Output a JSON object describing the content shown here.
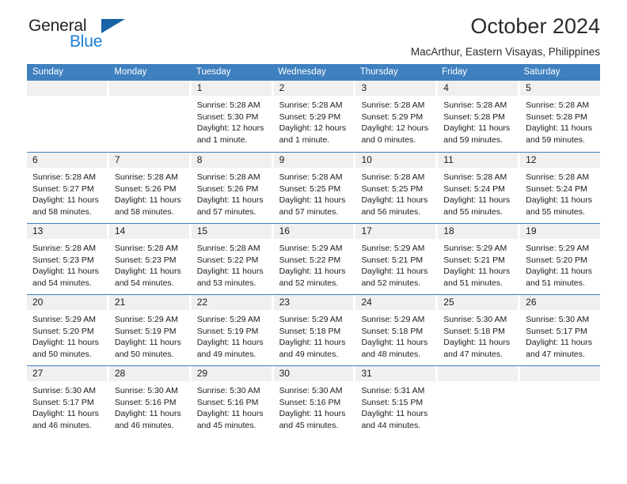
{
  "brand": {
    "name_top": "General",
    "name_bottom": "Blue",
    "triangle_color": "#1763a5",
    "blue_color": "#1b7fd4"
  },
  "header": {
    "title": "October 2024",
    "location": "MacArthur, Eastern Visayas, Philippines"
  },
  "theme": {
    "header_blue": "#3f80bf",
    "day_band_gray": "#f0f0f0"
  },
  "weekdays": [
    "Sunday",
    "Monday",
    "Tuesday",
    "Wednesday",
    "Thursday",
    "Friday",
    "Saturday"
  ],
  "weeks": [
    [
      {
        "date": "",
        "sunrise": "",
        "sunset": "",
        "daylight": ""
      },
      {
        "date": "",
        "sunrise": "",
        "sunset": "",
        "daylight": ""
      },
      {
        "date": "1",
        "sunrise": "Sunrise: 5:28 AM",
        "sunset": "Sunset: 5:30 PM",
        "daylight": "Daylight: 12 hours and 1 minute."
      },
      {
        "date": "2",
        "sunrise": "Sunrise: 5:28 AM",
        "sunset": "Sunset: 5:29 PM",
        "daylight": "Daylight: 12 hours and 1 minute."
      },
      {
        "date": "3",
        "sunrise": "Sunrise: 5:28 AM",
        "sunset": "Sunset: 5:29 PM",
        "daylight": "Daylight: 12 hours and 0 minutes."
      },
      {
        "date": "4",
        "sunrise": "Sunrise: 5:28 AM",
        "sunset": "Sunset: 5:28 PM",
        "daylight": "Daylight: 11 hours and 59 minutes."
      },
      {
        "date": "5",
        "sunrise": "Sunrise: 5:28 AM",
        "sunset": "Sunset: 5:28 PM",
        "daylight": "Daylight: 11 hours and 59 minutes."
      }
    ],
    [
      {
        "date": "6",
        "sunrise": "Sunrise: 5:28 AM",
        "sunset": "Sunset: 5:27 PM",
        "daylight": "Daylight: 11 hours and 58 minutes."
      },
      {
        "date": "7",
        "sunrise": "Sunrise: 5:28 AM",
        "sunset": "Sunset: 5:26 PM",
        "daylight": "Daylight: 11 hours and 58 minutes."
      },
      {
        "date": "8",
        "sunrise": "Sunrise: 5:28 AM",
        "sunset": "Sunset: 5:26 PM",
        "daylight": "Daylight: 11 hours and 57 minutes."
      },
      {
        "date": "9",
        "sunrise": "Sunrise: 5:28 AM",
        "sunset": "Sunset: 5:25 PM",
        "daylight": "Daylight: 11 hours and 57 minutes."
      },
      {
        "date": "10",
        "sunrise": "Sunrise: 5:28 AM",
        "sunset": "Sunset: 5:25 PM",
        "daylight": "Daylight: 11 hours and 56 minutes."
      },
      {
        "date": "11",
        "sunrise": "Sunrise: 5:28 AM",
        "sunset": "Sunset: 5:24 PM",
        "daylight": "Daylight: 11 hours and 55 minutes."
      },
      {
        "date": "12",
        "sunrise": "Sunrise: 5:28 AM",
        "sunset": "Sunset: 5:24 PM",
        "daylight": "Daylight: 11 hours and 55 minutes."
      }
    ],
    [
      {
        "date": "13",
        "sunrise": "Sunrise: 5:28 AM",
        "sunset": "Sunset: 5:23 PM",
        "daylight": "Daylight: 11 hours and 54 minutes."
      },
      {
        "date": "14",
        "sunrise": "Sunrise: 5:28 AM",
        "sunset": "Sunset: 5:23 PM",
        "daylight": "Daylight: 11 hours and 54 minutes."
      },
      {
        "date": "15",
        "sunrise": "Sunrise: 5:28 AM",
        "sunset": "Sunset: 5:22 PM",
        "daylight": "Daylight: 11 hours and 53 minutes."
      },
      {
        "date": "16",
        "sunrise": "Sunrise: 5:29 AM",
        "sunset": "Sunset: 5:22 PM",
        "daylight": "Daylight: 11 hours and 52 minutes."
      },
      {
        "date": "17",
        "sunrise": "Sunrise: 5:29 AM",
        "sunset": "Sunset: 5:21 PM",
        "daylight": "Daylight: 11 hours and 52 minutes."
      },
      {
        "date": "18",
        "sunrise": "Sunrise: 5:29 AM",
        "sunset": "Sunset: 5:21 PM",
        "daylight": "Daylight: 11 hours and 51 minutes."
      },
      {
        "date": "19",
        "sunrise": "Sunrise: 5:29 AM",
        "sunset": "Sunset: 5:20 PM",
        "daylight": "Daylight: 11 hours and 51 minutes."
      }
    ],
    [
      {
        "date": "20",
        "sunrise": "Sunrise: 5:29 AM",
        "sunset": "Sunset: 5:20 PM",
        "daylight": "Daylight: 11 hours and 50 minutes."
      },
      {
        "date": "21",
        "sunrise": "Sunrise: 5:29 AM",
        "sunset": "Sunset: 5:19 PM",
        "daylight": "Daylight: 11 hours and 50 minutes."
      },
      {
        "date": "22",
        "sunrise": "Sunrise: 5:29 AM",
        "sunset": "Sunset: 5:19 PM",
        "daylight": "Daylight: 11 hours and 49 minutes."
      },
      {
        "date": "23",
        "sunrise": "Sunrise: 5:29 AM",
        "sunset": "Sunset: 5:18 PM",
        "daylight": "Daylight: 11 hours and 49 minutes."
      },
      {
        "date": "24",
        "sunrise": "Sunrise: 5:29 AM",
        "sunset": "Sunset: 5:18 PM",
        "daylight": "Daylight: 11 hours and 48 minutes."
      },
      {
        "date": "25",
        "sunrise": "Sunrise: 5:30 AM",
        "sunset": "Sunset: 5:18 PM",
        "daylight": "Daylight: 11 hours and 47 minutes."
      },
      {
        "date": "26",
        "sunrise": "Sunrise: 5:30 AM",
        "sunset": "Sunset: 5:17 PM",
        "daylight": "Daylight: 11 hours and 47 minutes."
      }
    ],
    [
      {
        "date": "27",
        "sunrise": "Sunrise: 5:30 AM",
        "sunset": "Sunset: 5:17 PM",
        "daylight": "Daylight: 11 hours and 46 minutes."
      },
      {
        "date": "28",
        "sunrise": "Sunrise: 5:30 AM",
        "sunset": "Sunset: 5:16 PM",
        "daylight": "Daylight: 11 hours and 46 minutes."
      },
      {
        "date": "29",
        "sunrise": "Sunrise: 5:30 AM",
        "sunset": "Sunset: 5:16 PM",
        "daylight": "Daylight: 11 hours and 45 minutes."
      },
      {
        "date": "30",
        "sunrise": "Sunrise: 5:30 AM",
        "sunset": "Sunset: 5:16 PM",
        "daylight": "Daylight: 11 hours and 45 minutes."
      },
      {
        "date": "31",
        "sunrise": "Sunrise: 5:31 AM",
        "sunset": "Sunset: 5:15 PM",
        "daylight": "Daylight: 11 hours and 44 minutes."
      },
      {
        "date": "",
        "sunrise": "",
        "sunset": "",
        "daylight": ""
      },
      {
        "date": "",
        "sunrise": "",
        "sunset": "",
        "daylight": ""
      }
    ]
  ]
}
